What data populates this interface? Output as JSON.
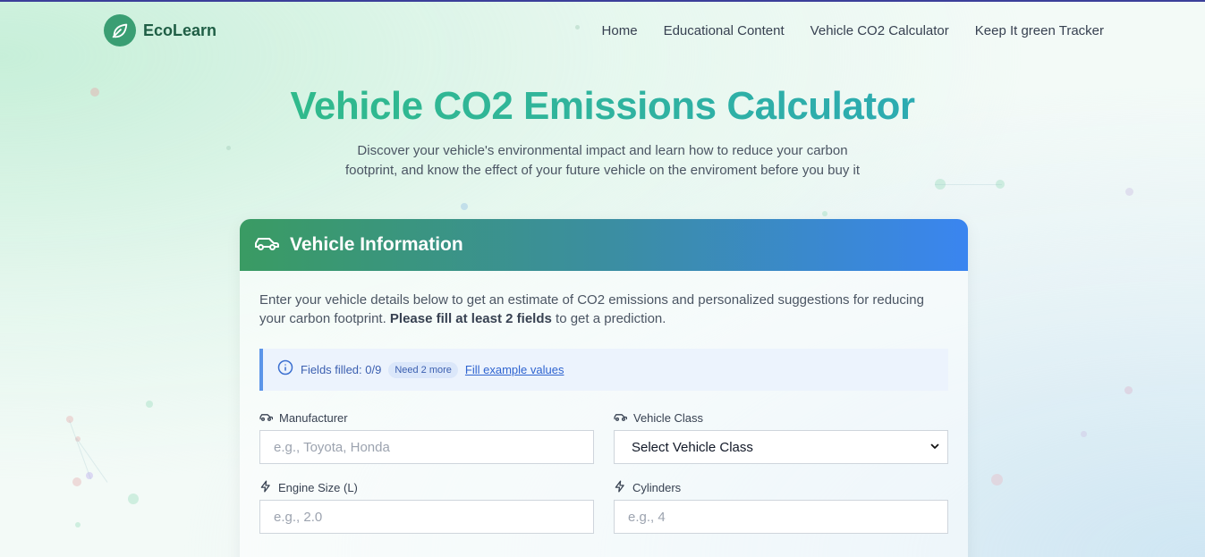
{
  "header": {
    "brand_name": "EcoLearn",
    "nav": [
      "Home",
      "Educational Content",
      "Vehicle CO2 Calculator",
      "Keep It green Tracker"
    ]
  },
  "hero": {
    "title": "Vehicle CO2 Emissions Calculator",
    "subtitle_line1": "Discover your vehicle's environmental impact and learn how to reduce your carbon",
    "subtitle_line2": "footprint, and know the effect of your future vehicle on the enviroment before you buy it"
  },
  "card": {
    "title": "Vehicle Information",
    "intro_start": "Enter your vehicle details below to get an estimate of CO2 emissions and personalized suggestions for reducing your carbon footprint. ",
    "intro_bold": "Please fill at least 2 fields",
    "intro_end": " to get a prediction."
  },
  "status": {
    "fields_filled": "Fields filled: 0/9",
    "badge": "Need 2 more",
    "link": "Fill example values"
  },
  "fields": {
    "manufacturer": {
      "label": "Manufacturer",
      "placeholder": "e.g., Toyota, Honda",
      "icon": "car-icon"
    },
    "vehicle_class": {
      "label": "Vehicle Class",
      "selected": "Select Vehicle Class",
      "icon": "car-icon"
    },
    "engine_size": {
      "label": "Engine Size (L)",
      "placeholder": "e.g., 2.0",
      "icon": "lightning-icon"
    },
    "cylinders": {
      "label": "Cylinders",
      "placeholder": "e.g., 4",
      "icon": "lightning-icon"
    }
  },
  "colors": {
    "brand": "#3a9e73",
    "header_gradient_start": "#3a9b63",
    "header_gradient_end": "#3a85f0",
    "title_gradient_start": "#2fbf7a",
    "title_gradient_end": "#2aa3c4",
    "info_accent": "#5b95e9"
  }
}
